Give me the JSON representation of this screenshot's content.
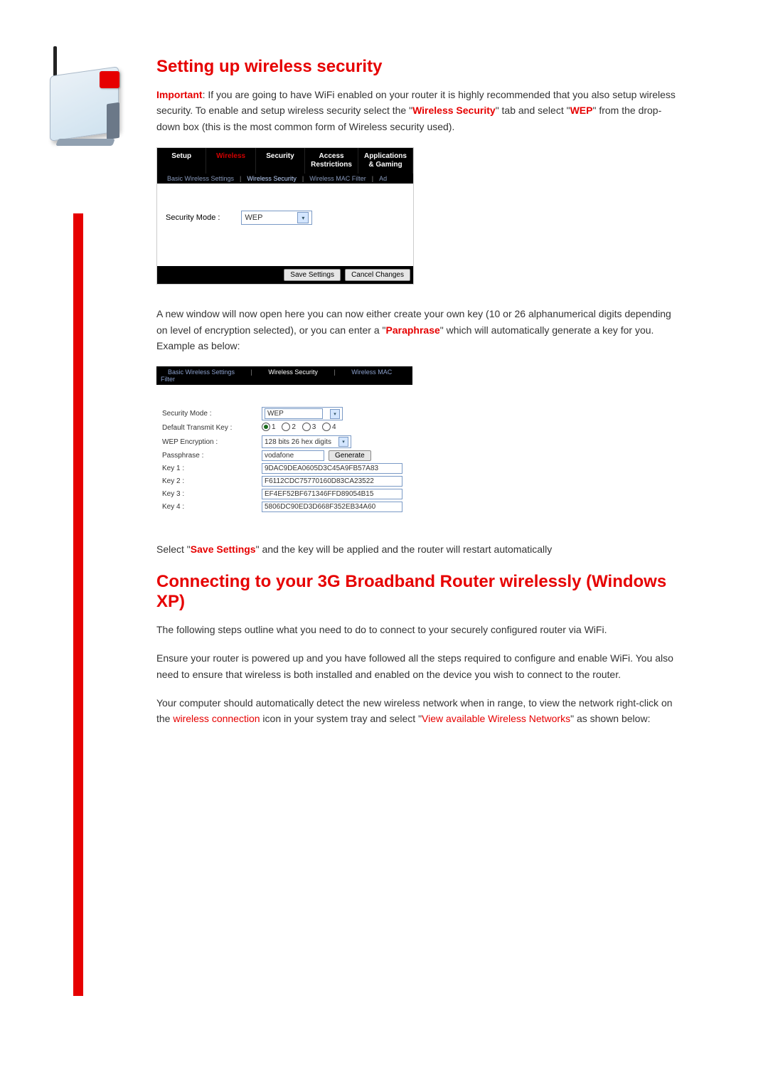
{
  "heading1": "Setting up wireless security",
  "intro_important": "Important",
  "intro_text1": ": If you are going to have WiFi enabled on your router it is highly recommended that you also setup wireless security.  To enable and setup wireless security select the \"",
  "intro_hl1": "Wireless Security",
  "intro_text2": "\" tab and select \"",
  "intro_hl2": "WEP",
  "intro_text3": "\" from the drop-down box (this is the most common form of Wireless security used).",
  "panel1": {
    "tabs": [
      "Setup",
      "Wireless",
      "Security",
      "Access Restrictions",
      "Applications & Gaming"
    ],
    "subtabs": [
      "Basic Wireless Settings",
      "Wireless Security",
      "Wireless MAC Filter",
      "Ad"
    ],
    "label_security_mode": "Security Mode :",
    "dropdown_value": "WEP",
    "btn_save": "Save Settings",
    "btn_cancel": "Cancel Changes"
  },
  "mid_text1": "A new window will now open here you can now either create your own key (10 or 26 alphanumerical digits depending on level of encryption selected), or you can enter a \"",
  "mid_hl": "Paraphrase",
  "mid_text2": "\" which will automatically generate a key for you. Example as below:",
  "panel2": {
    "subtabs": [
      "Basic Wireless Settings",
      "Wireless Security",
      "Wireless MAC Filter"
    ],
    "label_security_mode": "Security Mode :",
    "sec_mode_value": "WEP",
    "label_default_key": "Default Transmit  Key :",
    "radios": [
      "1",
      "2",
      "3",
      "4"
    ],
    "label_wep_enc": "WEP Encryption :",
    "wep_enc_value": "128 bits 26 hex digits",
    "label_passphrase": "Passphrase :",
    "passphrase": "vodafone",
    "btn_generate": "Generate",
    "label_key1": "Key 1 :",
    "key1": "9DAC9DEA0605D3C45A9FB57A83",
    "label_key2": "Key 2 :",
    "key2": "F6112CDC75770160D83CA23522",
    "label_key3": "Key 3 :",
    "key3": "EF4EF52BF671346FFD89054B15",
    "label_key4": "Key 4 :",
    "key4": "5806DC90ED3D668F352EB34A60"
  },
  "after2_text1": "Select \"",
  "after2_hl": "Save Settings",
  "after2_text2": "\" and the key will be applied and the router will restart automatically",
  "heading2": "Connecting to your 3G Broadband Router wirelessly (Windows XP)",
  "para3": "The following steps outline what you need to do to connect to your securely configured router via WiFi.",
  "para4": "Ensure your router is powered up and you have followed all the steps required to configure and enable WiFi. You also need to ensure that wireless is both installed and enabled on the device you wish to connect to the router.",
  "para5_a": "Your computer should automatically detect the new wireless network when in range, to view the network right-click on the ",
  "para5_hl1": "wireless connection",
  "para5_b": " icon in your system tray and select \"",
  "para5_hl2": "View available Wireless Networks",
  "para5_c": "\" as shown below:"
}
